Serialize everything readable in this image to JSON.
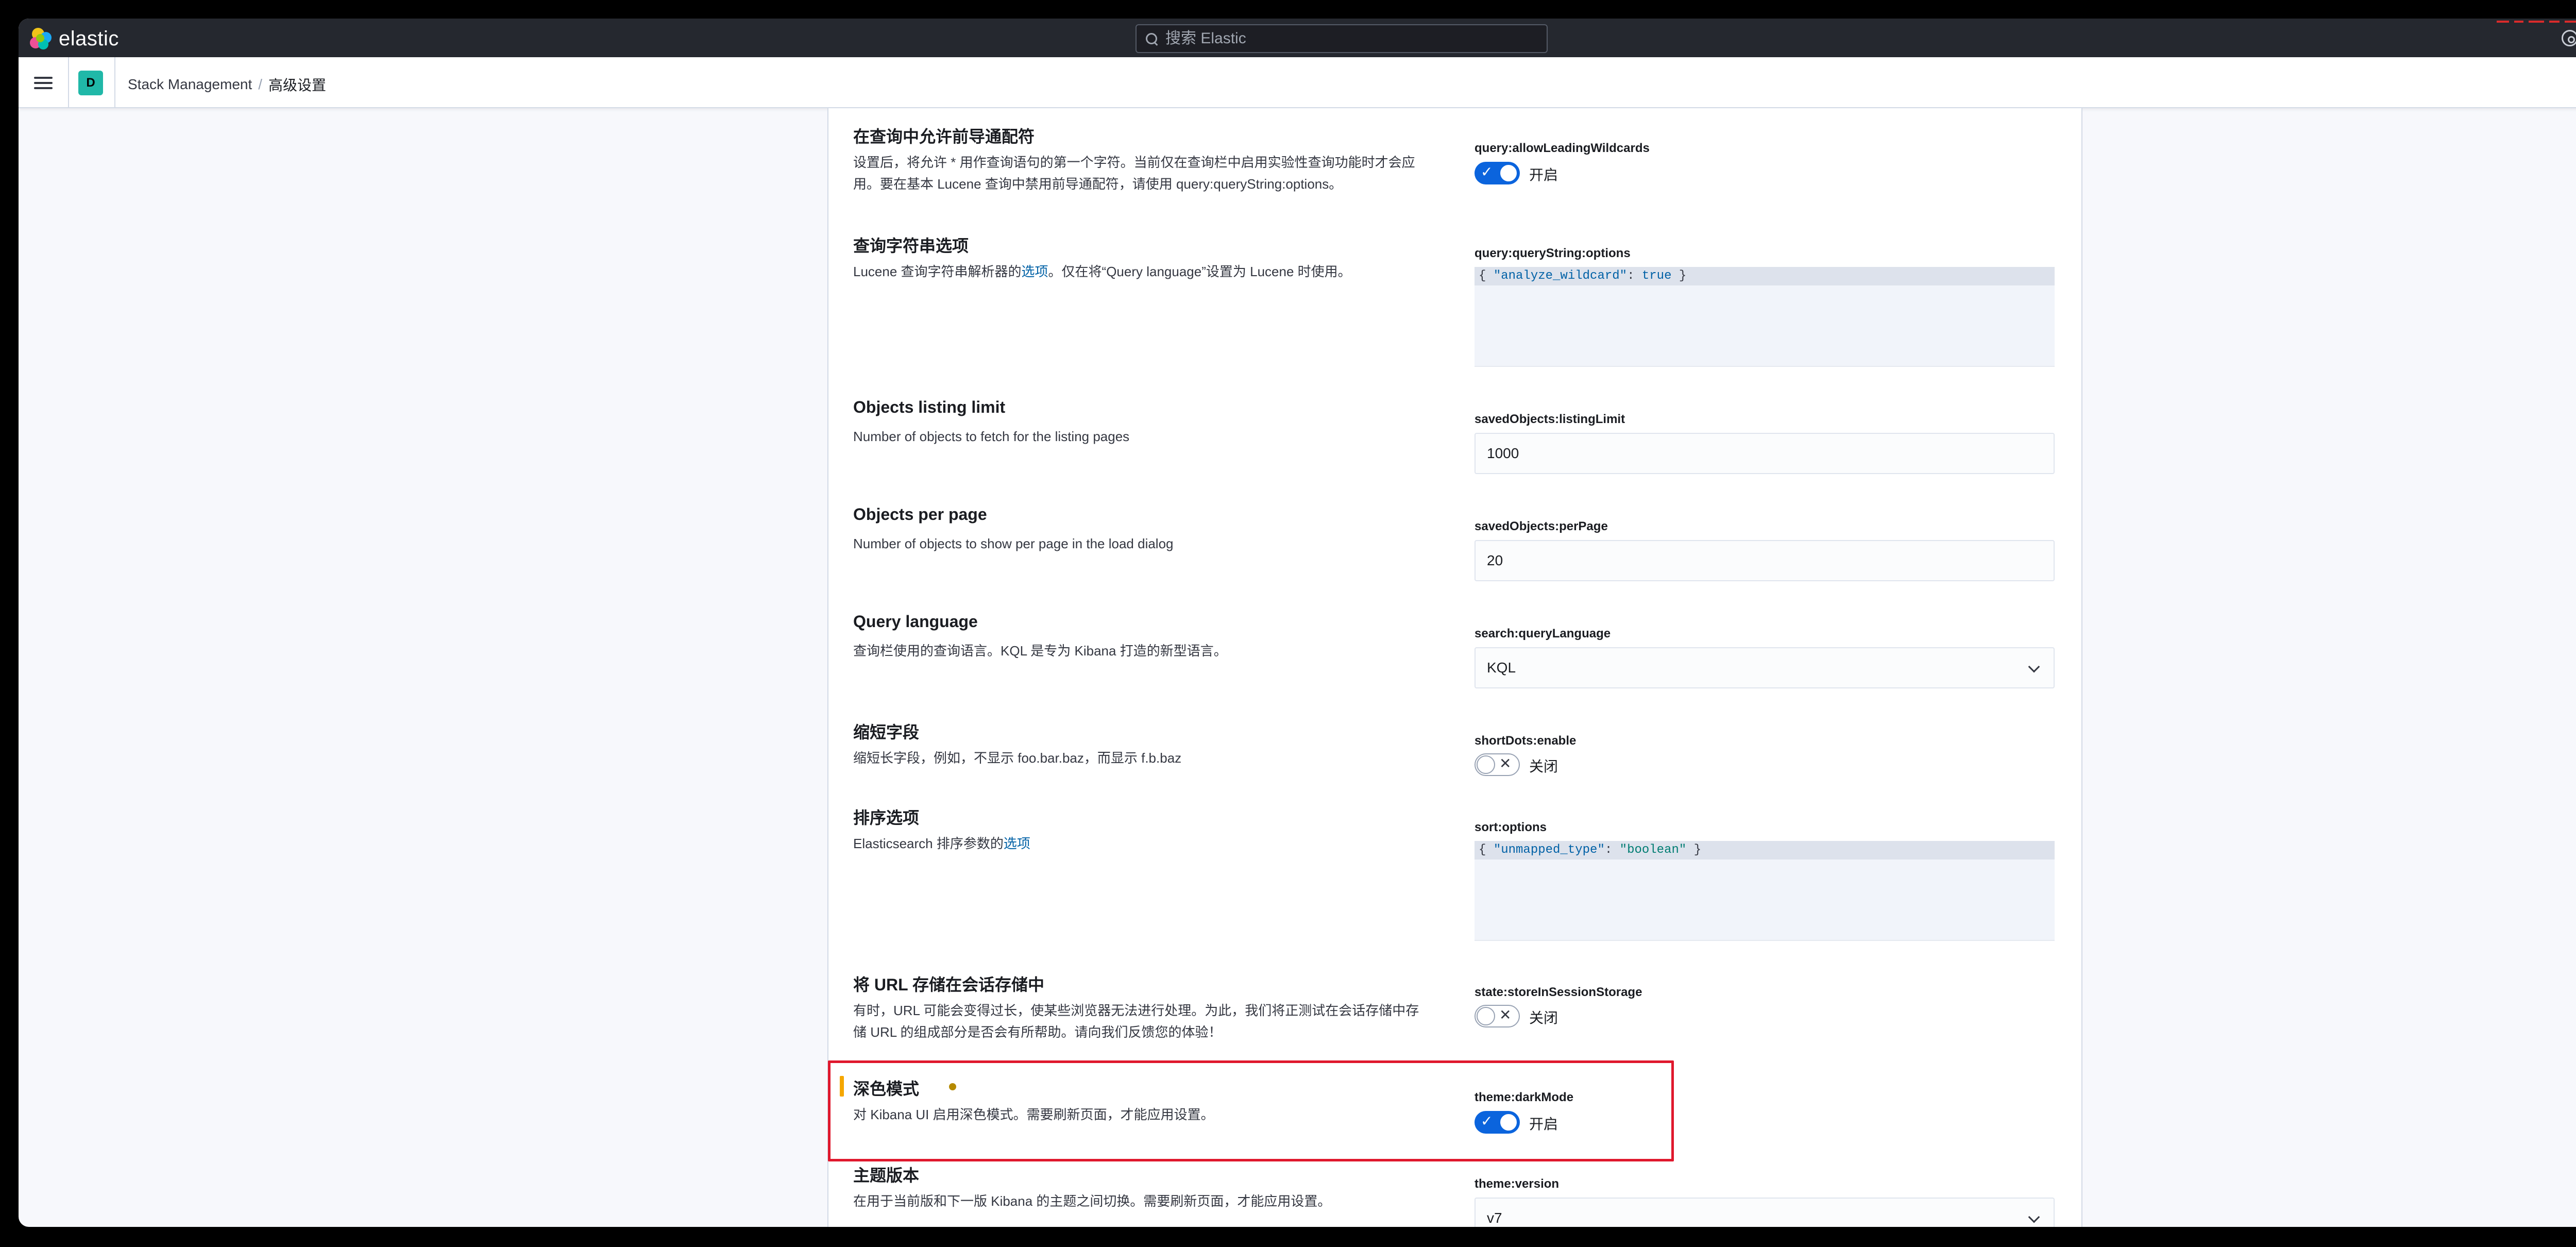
{
  "app": {
    "logo_text": "elastic",
    "search_placeholder": "搜索 Elastic"
  },
  "breadcrumb": {
    "space_initial": "D",
    "root": "Stack Management",
    "separator": "/",
    "current": "高级设置"
  },
  "settings": [
    {
      "title": "在查询中允许前导通配符",
      "description": "设置后，将允许 * 用作查询语句的第一个字符。当前仅在查询栏中启用实验性查询功能时才会应用。要在基本 Lucene 查询中禁用前导通配符，请使用 query:queryString:options。",
      "key": "query:allowLeadingWildcards",
      "control": "toggle",
      "state": "开启",
      "on": true
    },
    {
      "title": "查询字符串选项",
      "description_prefix": "Lucene 查询字符串解析器的",
      "description_link": "选项",
      "description_suffix": "。仅在将“Query language”设置为 Lucene 时使用。",
      "key": "query:queryString:options",
      "control": "code",
      "code": {
        "open": "{ ",
        "key": "\"analyze_wildcard\"",
        "colon": ": ",
        "value": "true",
        "close": " }"
      }
    },
    {
      "title": "Objects listing limit",
      "description": "Number of objects to fetch for the listing pages",
      "key": "savedObjects:listingLimit",
      "control": "number",
      "value": "1000"
    },
    {
      "title": "Objects per page",
      "description": "Number of objects to show per page in the load dialog",
      "key": "savedObjects:perPage",
      "control": "number",
      "value": "20"
    },
    {
      "title": "Query language",
      "description": "查询栏使用的查询语言。KQL 是专为 Kibana 打造的新型语言。",
      "key": "search:queryLanguage",
      "control": "select",
      "value": "KQL"
    },
    {
      "title": "缩短字段",
      "description": "缩短长字段，例如，不显示 foo.bar.baz，而显示 f.b.baz",
      "key": "shortDots:enable",
      "control": "toggle",
      "state": "关闭",
      "on": false
    },
    {
      "title": "排序选项",
      "description_prefix": "Elasticsearch 排序参数的",
      "description_link": "选项",
      "key": "sort:options",
      "control": "code",
      "code": {
        "open": "{ ",
        "key": "\"unmapped_type\"",
        "colon": ": ",
        "value": "\"boolean\"",
        "close": " }"
      }
    },
    {
      "title": "将 URL 存储在会话存储中",
      "description": "有时，URL 可能会变得过长，使某些浏览器无法进行处理。为此，我们将正测试在会话存储中存储 URL 的组成部分是否会有所帮助。请向我们反馈您的体验！",
      "key": "state:storeInSessionStorage",
      "control": "toggle",
      "state": "关闭",
      "on": false
    },
    {
      "title": "深色模式",
      "description": "对 Kibana UI 启用深色模式。需要刷新页面，才能应用设置。",
      "key": "theme:darkMode",
      "control": "toggle",
      "state": "开启",
      "on": true,
      "unsaved": true
    },
    {
      "title": "主题版本",
      "description": "在用于当前版和下一版 Kibana 的主题之间切换。需要刷新页面，才能应用设置。",
      "key": "theme:version",
      "control": "select",
      "value": "v7"
    }
  ],
  "colors": {
    "header_bg": "#25282f",
    "accent": "#0b64dd",
    "link": "#0061a6",
    "unsaved": "#f5a700",
    "highlight": "#e0182d",
    "space_avatar": "#20b8a8"
  }
}
